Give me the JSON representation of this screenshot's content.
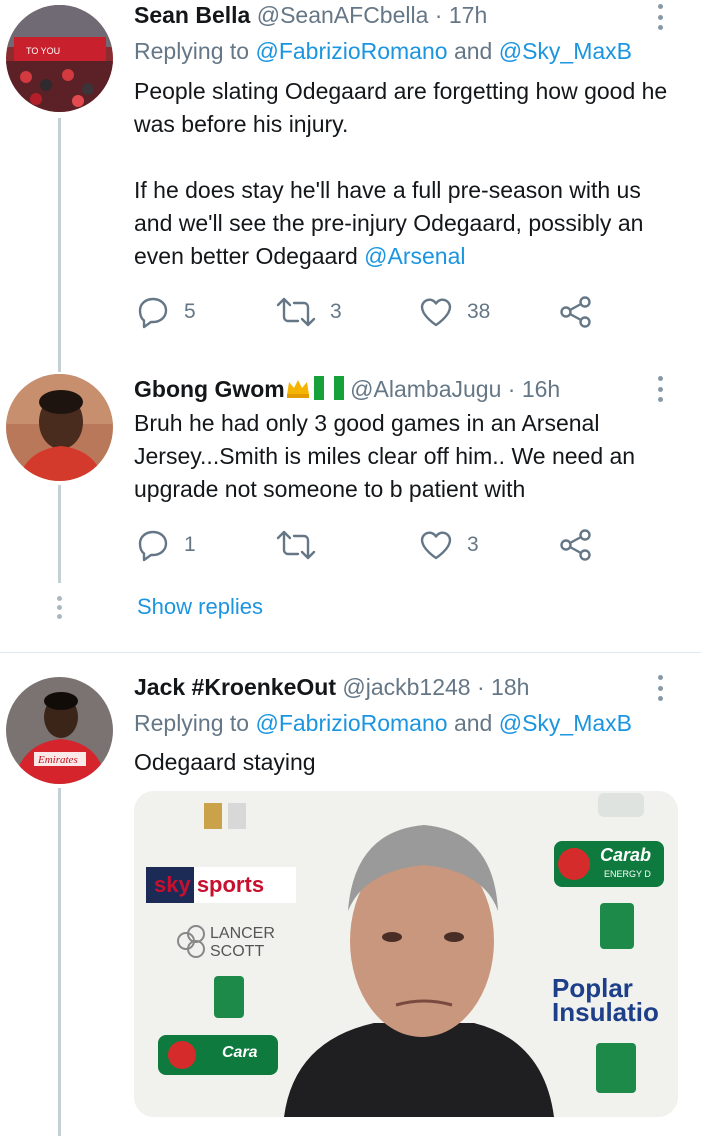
{
  "tweets": [
    {
      "name": "Sean Bella",
      "handle": "@SeanAFCbella",
      "sep": " · ",
      "time": "17h",
      "replying_prefix": "Replying to ",
      "replying_user1": "@FabrizioRomano",
      "replying_and": " and ",
      "replying_user2": "@Sky_MaxB",
      "text_p1": "People slating Odegaard are forgetting how good he was before his injury.",
      "text_p2": "If he does stay he'll have a full pre-season with us and we'll see the pre-injury Odegaard, possibly an even better Odegaard ",
      "text_mention": "@Arsenal",
      "replies": "5",
      "retweets": "3",
      "likes": "38"
    },
    {
      "name": "Gbong Gwom",
      "handle": "@AlambaJugu",
      "sep": " · ",
      "time": "16h",
      "text": "Bruh he had only 3 good games in an Arsenal Jersey...Smith is miles clear off him.. We need an upgrade not someone to b patient with",
      "replies": "1",
      "retweets": "",
      "likes": "3",
      "show_replies": "Show replies"
    },
    {
      "name": "Jack #KroenkeOut",
      "handle": "@jackb1248",
      "sep": " · ",
      "time": "18h",
      "replying_prefix": "Replying to ",
      "replying_user1": "@FabrizioRomano",
      "replying_and": " and ",
      "replying_user2": "@Sky_MaxB",
      "text": "Odegaard staying",
      "media": {
        "sky_label": "sky sports",
        "lancer_label": "LANCER",
        "scott_label": "SCOTT",
        "carabao_label": "Carab",
        "energy_label": "ENERGY D",
        "popular_label": "Poplar",
        "insulation_label": "Insulatio",
        "cara_label": "Cara"
      }
    }
  ],
  "colors": {
    "link": "#1b95e0",
    "muted": "#657786",
    "text": "#14171a",
    "thread_line": "#c4cfd6"
  },
  "icons": [
    "reply-icon",
    "retweet-icon",
    "like-icon",
    "share-icon",
    "more-options-icon",
    "crown-emoji",
    "nigeria-flag-emoji"
  ]
}
